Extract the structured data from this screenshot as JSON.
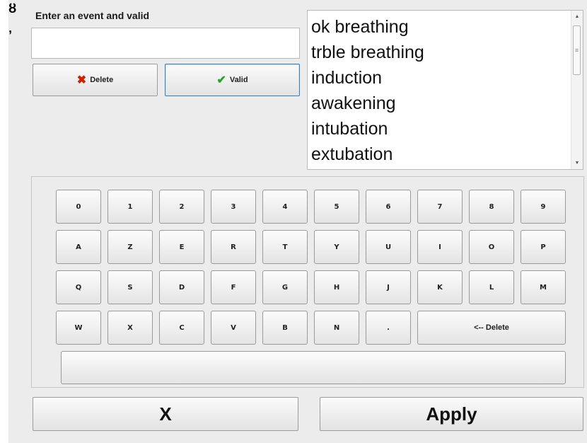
{
  "side_glyphs": [
    "ȣ",
    "ʼ"
  ],
  "entry": {
    "label": "Enter an event and valid",
    "value": "",
    "delete_label": "Delete",
    "delete_icon": "x-icon",
    "valid_label": "Valid",
    "valid_icon": "checkmark-icon"
  },
  "event_list": {
    "items": [
      "ok breathing",
      "trble breathing",
      "induction",
      "awakening",
      "intubation",
      "extubation"
    ]
  },
  "keyboard": {
    "rows": [
      [
        "0",
        "1",
        "2",
        "3",
        "4",
        "5",
        "6",
        "7",
        "8",
        "9"
      ],
      [
        "A",
        "Z",
        "E",
        "R",
        "T",
        "Y",
        "U",
        "I",
        "O",
        "P"
      ],
      [
        "Q",
        "S",
        "D",
        "F",
        "G",
        "H",
        "J",
        "K",
        "L",
        "M"
      ],
      [
        "W",
        "X",
        "C",
        "V",
        "B",
        "N",
        "."
      ]
    ],
    "backspace_label": "<-- Delete",
    "space_label": ""
  },
  "footer": {
    "cancel_label": "X",
    "apply_label": "Apply"
  },
  "colors": {
    "delete_icon": "#cc2200",
    "valid_icon": "#2aa32a",
    "panel_bg": "#ececec"
  }
}
